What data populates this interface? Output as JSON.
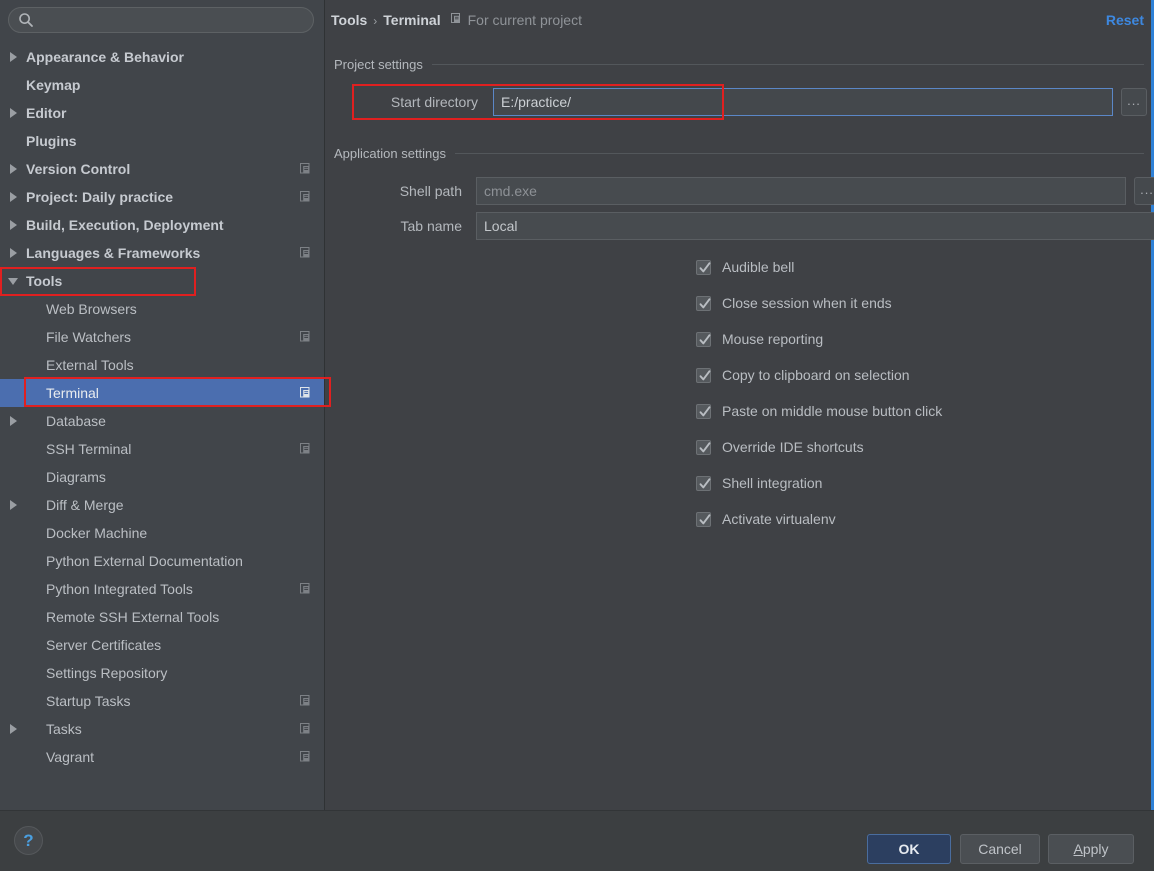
{
  "colors": {
    "accent_blue": "#3d88e0",
    "selection_blue": "#4b6eaf",
    "annotation_red": "#e02020",
    "sidebar_bg": "#41454a",
    "panel_bg": "#3f4145",
    "ok_button_bg": "#2c3f60"
  },
  "search": {
    "value": "",
    "placeholder": "",
    "icon": "search-icon"
  },
  "sidebar": {
    "items": [
      {
        "label": "Appearance & Behavior",
        "arrow": "right",
        "level": 1,
        "bold": true,
        "scope_icon": false,
        "selected": false
      },
      {
        "label": "Keymap",
        "arrow": "none",
        "level": 1,
        "bold": true,
        "scope_icon": false,
        "selected": false
      },
      {
        "label": "Editor",
        "arrow": "right",
        "level": 1,
        "bold": true,
        "scope_icon": false,
        "selected": false
      },
      {
        "label": "Plugins",
        "arrow": "none",
        "level": 1,
        "bold": true,
        "scope_icon": false,
        "selected": false
      },
      {
        "label": "Version Control",
        "arrow": "right",
        "level": 1,
        "bold": true,
        "scope_icon": true,
        "selected": false
      },
      {
        "label": "Project: Daily practice",
        "arrow": "right",
        "level": 1,
        "bold": true,
        "scope_icon": true,
        "selected": false
      },
      {
        "label": "Build, Execution, Deployment",
        "arrow": "right",
        "level": 1,
        "bold": true,
        "scope_icon": false,
        "selected": false
      },
      {
        "label": "Languages & Frameworks",
        "arrow": "right",
        "level": 1,
        "bold": true,
        "scope_icon": true,
        "selected": false
      },
      {
        "label": "Tools",
        "arrow": "down",
        "level": 1,
        "bold": true,
        "scope_icon": false,
        "selected": false
      },
      {
        "label": "Web Browsers",
        "arrow": "none",
        "level": 2,
        "bold": false,
        "scope_icon": false,
        "selected": false
      },
      {
        "label": "File Watchers",
        "arrow": "none",
        "level": 2,
        "bold": false,
        "scope_icon": true,
        "selected": false
      },
      {
        "label": "External Tools",
        "arrow": "none",
        "level": 2,
        "bold": false,
        "scope_icon": false,
        "selected": false
      },
      {
        "label": "Terminal",
        "arrow": "none",
        "level": 2,
        "bold": false,
        "scope_icon": true,
        "selected": true
      },
      {
        "label": "Database",
        "arrow": "right",
        "level": 2,
        "bold": false,
        "scope_icon": false,
        "selected": false
      },
      {
        "label": "SSH Terminal",
        "arrow": "none",
        "level": 2,
        "bold": false,
        "scope_icon": true,
        "selected": false
      },
      {
        "label": "Diagrams",
        "arrow": "none",
        "level": 2,
        "bold": false,
        "scope_icon": false,
        "selected": false
      },
      {
        "label": "Diff & Merge",
        "arrow": "right",
        "level": 2,
        "bold": false,
        "scope_icon": false,
        "selected": false
      },
      {
        "label": "Docker Machine",
        "arrow": "none",
        "level": 2,
        "bold": false,
        "scope_icon": false,
        "selected": false
      },
      {
        "label": "Python External Documentation",
        "arrow": "none",
        "level": 2,
        "bold": false,
        "scope_icon": false,
        "selected": false
      },
      {
        "label": "Python Integrated Tools",
        "arrow": "none",
        "level": 2,
        "bold": false,
        "scope_icon": true,
        "selected": false
      },
      {
        "label": "Remote SSH External Tools",
        "arrow": "none",
        "level": 2,
        "bold": false,
        "scope_icon": false,
        "selected": false
      },
      {
        "label": "Server Certificates",
        "arrow": "none",
        "level": 2,
        "bold": false,
        "scope_icon": false,
        "selected": false
      },
      {
        "label": "Settings Repository",
        "arrow": "none",
        "level": 2,
        "bold": false,
        "scope_icon": false,
        "selected": false
      },
      {
        "label": "Startup Tasks",
        "arrow": "none",
        "level": 2,
        "bold": false,
        "scope_icon": true,
        "selected": false
      },
      {
        "label": "Tasks",
        "arrow": "right",
        "level": 2,
        "bold": false,
        "scope_icon": true,
        "selected": false
      },
      {
        "label": "Vagrant",
        "arrow": "none",
        "level": 2,
        "bold": false,
        "scope_icon": true,
        "selected": false
      }
    ]
  },
  "header": {
    "breadcrumb_parent": "Tools",
    "breadcrumb_separator": "›",
    "breadcrumb_current": "Terminal",
    "scope_note": "For current project",
    "scope_note_icon": "project-scope-icon",
    "reset_label": "Reset"
  },
  "project_settings": {
    "group_title": "Project settings",
    "start_directory_label": "Start directory",
    "start_directory_value": "E:/practice/",
    "start_directory_placeholder": "",
    "browse_label": "..."
  },
  "application_settings": {
    "group_title": "Application settings",
    "shell_path_label": "Shell path",
    "shell_path_value": "cmd.exe",
    "shell_path_placeholder": "cmd.exe",
    "shell_browse_label": "...",
    "tab_name_label": "Tab name",
    "tab_name_value": "Local",
    "tab_name_placeholder": "Local",
    "checkboxes": [
      {
        "label": "Audible bell",
        "checked": true
      },
      {
        "label": "Close session when it ends",
        "checked": true
      },
      {
        "label": "Mouse reporting",
        "checked": true
      },
      {
        "label": "Copy to clipboard on selection",
        "checked": true
      },
      {
        "label": "Paste on middle mouse button click",
        "checked": true
      },
      {
        "label": "Override IDE shortcuts",
        "checked": true
      },
      {
        "label": "Shell integration",
        "checked": true
      },
      {
        "label": "Activate virtualenv",
        "checked": true
      }
    ]
  },
  "footer": {
    "help_label": "?",
    "ok_label": "OK",
    "cancel_label": "Cancel",
    "apply_label_prefix": "A",
    "apply_label_rest": "pply"
  }
}
